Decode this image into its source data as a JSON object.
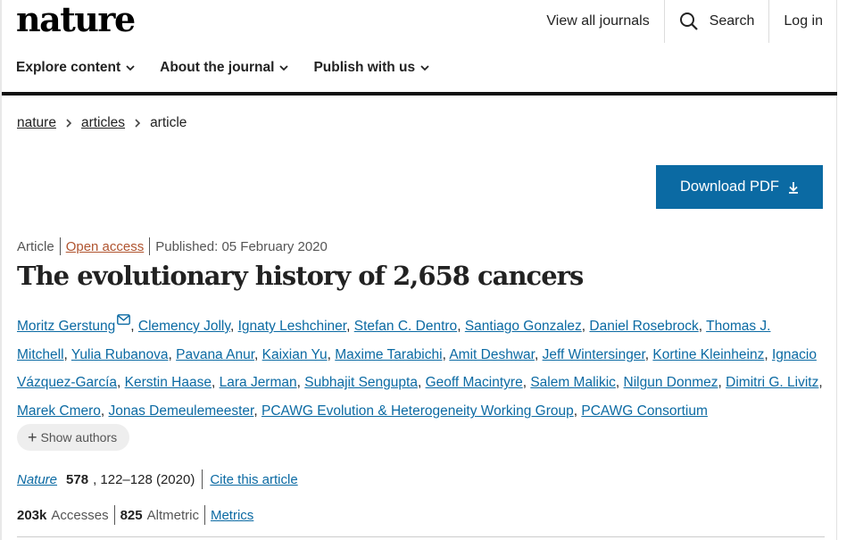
{
  "header": {
    "logo": "nature",
    "top_nav": {
      "view_all": "View all journals",
      "search": "Search",
      "login": "Log in"
    },
    "sub_nav": [
      "Explore content",
      "About the journal",
      "Publish with us"
    ]
  },
  "breadcrumb": [
    "nature",
    "articles",
    "article"
  ],
  "download_label": "Download PDF",
  "article": {
    "type": "Article",
    "access": "Open access",
    "published": "Published: 05 February 2020",
    "title": "The evolutionary history of 2,658 cancers",
    "authors": [
      "Moritz Gerstung",
      "Clemency Jolly",
      "Ignaty Leshchiner",
      "Stefan C. Dentro",
      "Santiago Gonzalez",
      "Daniel Rosebrock",
      "Thomas J. Mitchell",
      "Yulia Rubanova",
      "Pavana Anur",
      "Kaixian Yu",
      "Maxime Tarabichi",
      "Amit Deshwar",
      "Jeff Wintersinger",
      "Kortine Kleinheinz",
      "Ignacio Vázquez-García",
      "Kerstin Haase",
      "Lara Jerman",
      "Subhajit Sengupta",
      "Geoff Macintyre",
      "Salem Malikic",
      "Nilgun Donmez",
      "Dimitri G. Livitz",
      "Marek Cmero",
      "Jonas Demeulemeester",
      "PCAWG Evolution & Heterogeneity Working Group",
      "PCAWG Consortium"
    ],
    "show_authors": "Show authors",
    "citation": {
      "journal": "Nature",
      "volume": "578",
      "pages": ", 122–128 (2020)",
      "cite_label": "Cite this article"
    },
    "metrics": {
      "accesses_value": "203k",
      "accesses_label": "Accesses",
      "altmetric_value": "825",
      "altmetric_label": "Altmetric",
      "metrics_link": "Metrics"
    }
  },
  "colors": {
    "link": "#0b6aa3",
    "open_access": "#b0542f",
    "download_bg": "#0b6aa3"
  }
}
